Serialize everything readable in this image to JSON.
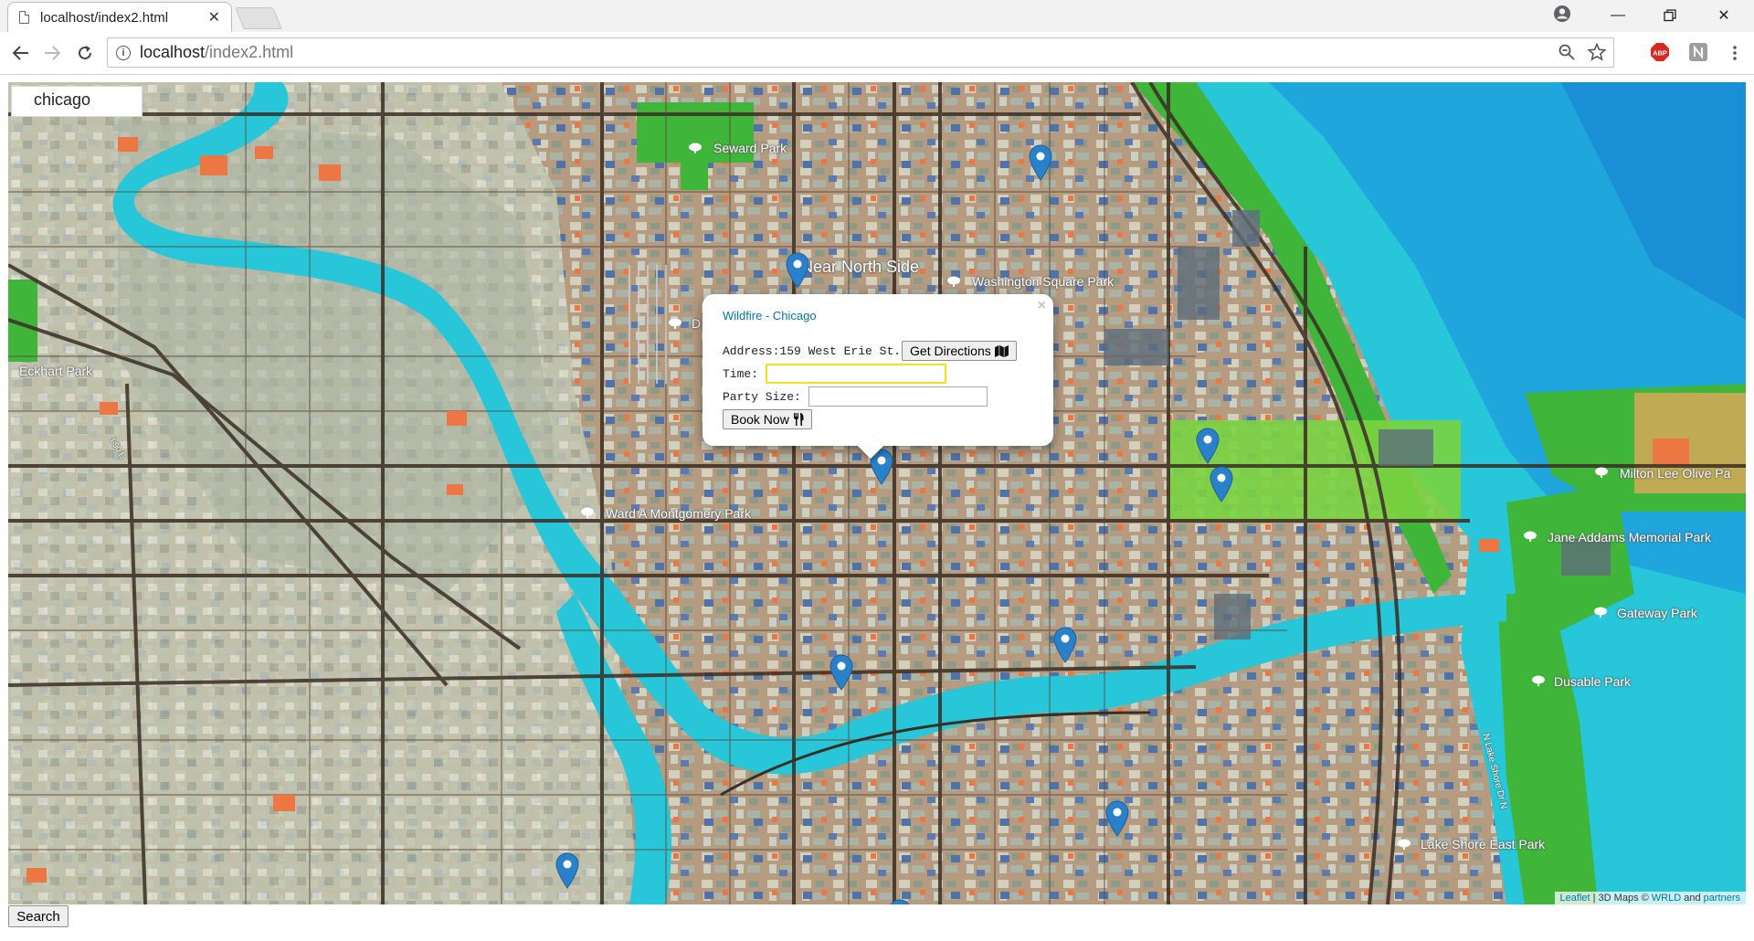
{
  "browser": {
    "tab_title": "localhost/index2.html",
    "url_host": "localhost",
    "url_path": "/index2.html"
  },
  "page": {
    "search_value": "chicago",
    "search_button_label": "Search",
    "attribution": {
      "leaflet": "Leaflet",
      "separator": " | 3D Maps © ",
      "wrld": "WRLD",
      "and": " and ",
      "partners": "partners"
    }
  },
  "map": {
    "labels": {
      "seward": "Seward Park",
      "near_north": "Near North Side",
      "washington": "Washington Square Park",
      "eckhart": "Eckhart Park",
      "ward": "Ward A Montgomery Park",
      "milton": "Milton Lee Olive Pa",
      "jane": "Jane Addams Memorial Park",
      "gateway": "Gateway Park",
      "dusable": "Dusable Park",
      "lakeshore": "Lake Shore East Park",
      "lsd": "N Lake Shore Dr N",
      "d": "D",
      "i90": "I-90 E"
    }
  },
  "popup": {
    "title": "Wildfire - Chicago",
    "close": "×",
    "address_label": "Address:",
    "address_value": "159 West Erie St.",
    "directions_label": "Get Directions",
    "time_label": "Time:",
    "party_label": "Party Size:",
    "book_label": "Book Now"
  },
  "colors": {
    "marker": "#2a81cb",
    "water": "#27c6d8",
    "park": "#3fb53a",
    "land": "#b59b80"
  }
}
